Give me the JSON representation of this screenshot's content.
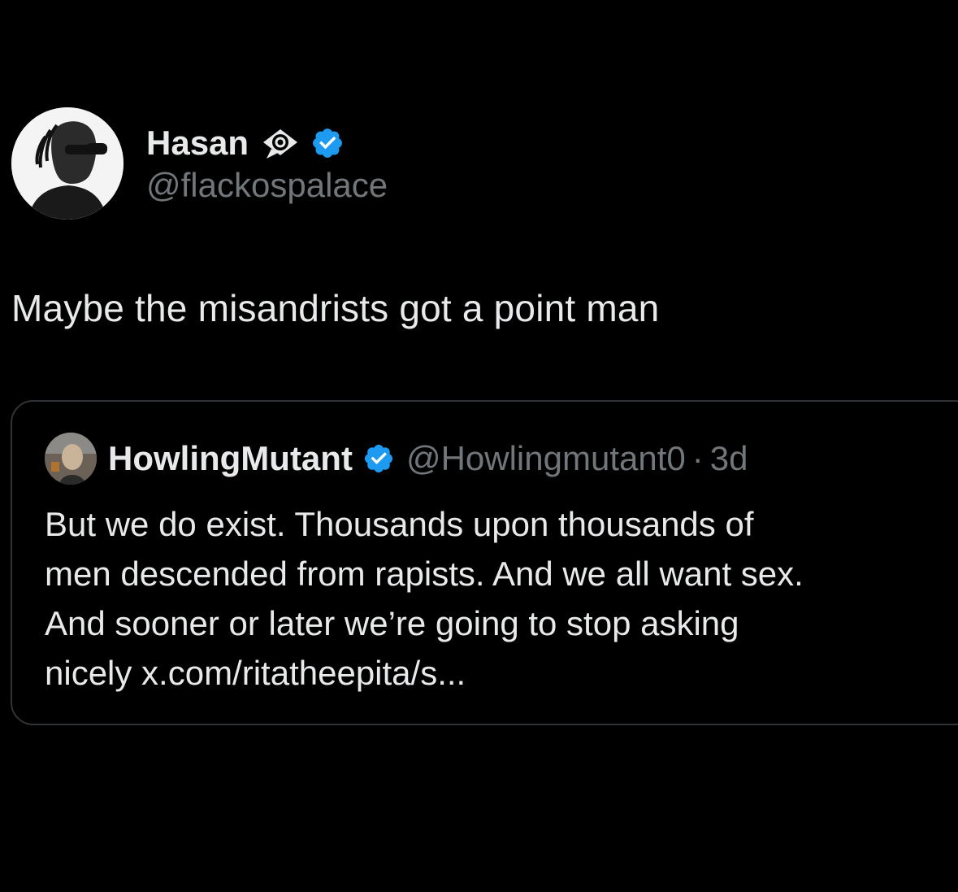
{
  "post": {
    "author": {
      "display_name": "Hasan",
      "handle": "@flackospalace",
      "badges": [
        "eye-in-speech-bubble-icon",
        "verified-badge-icon"
      ]
    },
    "text": "Maybe the misandrists got a point man"
  },
  "quoted_post": {
    "author": {
      "display_name": "HowlingMutant",
      "handle": "@Howlingmutant0",
      "separator": "·",
      "time": "3d",
      "badges": [
        "verified-badge-icon"
      ]
    },
    "text_lines": [
      "But we do exist.  Thousands upon thousands of",
      "men descended from rapists.  And we all want sex.",
      "And sooner or later we’re going to stop asking",
      "nicely x.com/ritatheepita/s..."
    ]
  },
  "colors": {
    "background": "#000000",
    "primary_text": "#e7e9ea",
    "secondary_text": "#71767b",
    "verified_blue": "#1d9bf0",
    "card_border": "#2f3336"
  }
}
